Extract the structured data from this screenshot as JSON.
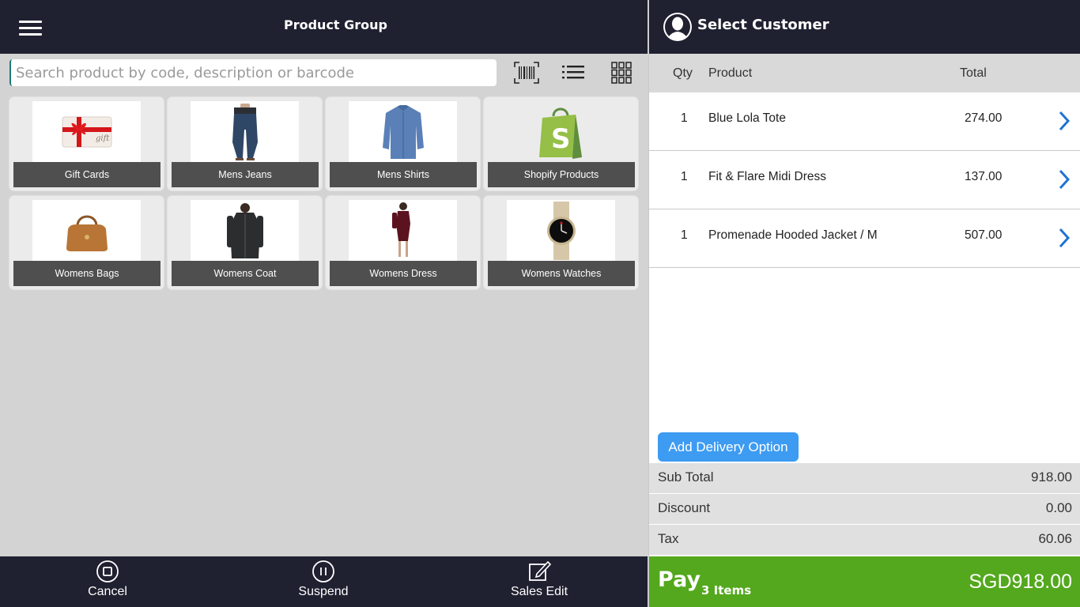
{
  "header": {
    "title": "Product Group"
  },
  "search": {
    "placeholder": "Search product by code, description or barcode",
    "value": ""
  },
  "toolbar": {
    "barcode_icon": "barcode-icon",
    "list_icon": "list-view-icon",
    "grid_icon": "grid-view-icon"
  },
  "product_groups": [
    {
      "label": "Gift Cards",
      "image": "gift-card-image"
    },
    {
      "label": "Mens Jeans",
      "image": "jeans-image"
    },
    {
      "label": "Mens Shirts",
      "image": "shirt-image"
    },
    {
      "label": "Shopify Products",
      "image": "shopify-bag-image"
    },
    {
      "label": "Womens Bags",
      "image": "handbag-image"
    },
    {
      "label": "Womens Coat",
      "image": "coat-image"
    },
    {
      "label": "Womens Dress",
      "image": "dress-image"
    },
    {
      "label": "Womens Watches",
      "image": "watch-image"
    }
  ],
  "footer": {
    "cancel": "Cancel",
    "suspend": "Suspend",
    "sales_edit": "Sales Edit"
  },
  "customer": {
    "label": "Select Customer"
  },
  "cart": {
    "headers": {
      "qty": "Qty",
      "product": "Product",
      "total": "Total"
    },
    "rows": [
      {
        "qty": "1",
        "product": "Blue Lola Tote",
        "total": "274.00"
      },
      {
        "qty": "1",
        "product": "Fit & Flare Midi Dress",
        "total": "137.00"
      },
      {
        "qty": "1",
        "product": "Promenade Hooded Jacket / M",
        "total": "507.00"
      }
    ]
  },
  "delivery": {
    "label": "Add Delivery Option"
  },
  "summary": {
    "subtotal_label": "Sub Total",
    "subtotal": "918.00",
    "discount_label": "Discount",
    "discount": "0.00",
    "tax_label": "Tax",
    "tax": "60.06"
  },
  "pay": {
    "label": "Pay",
    "items": "3 Items",
    "amount": "SGD918.00"
  },
  "colors": {
    "dark_bar": "#1f2030",
    "pay_green": "#53a81d",
    "accent_blue": "#3d9bf2",
    "chevron_blue": "#1f73d1"
  }
}
